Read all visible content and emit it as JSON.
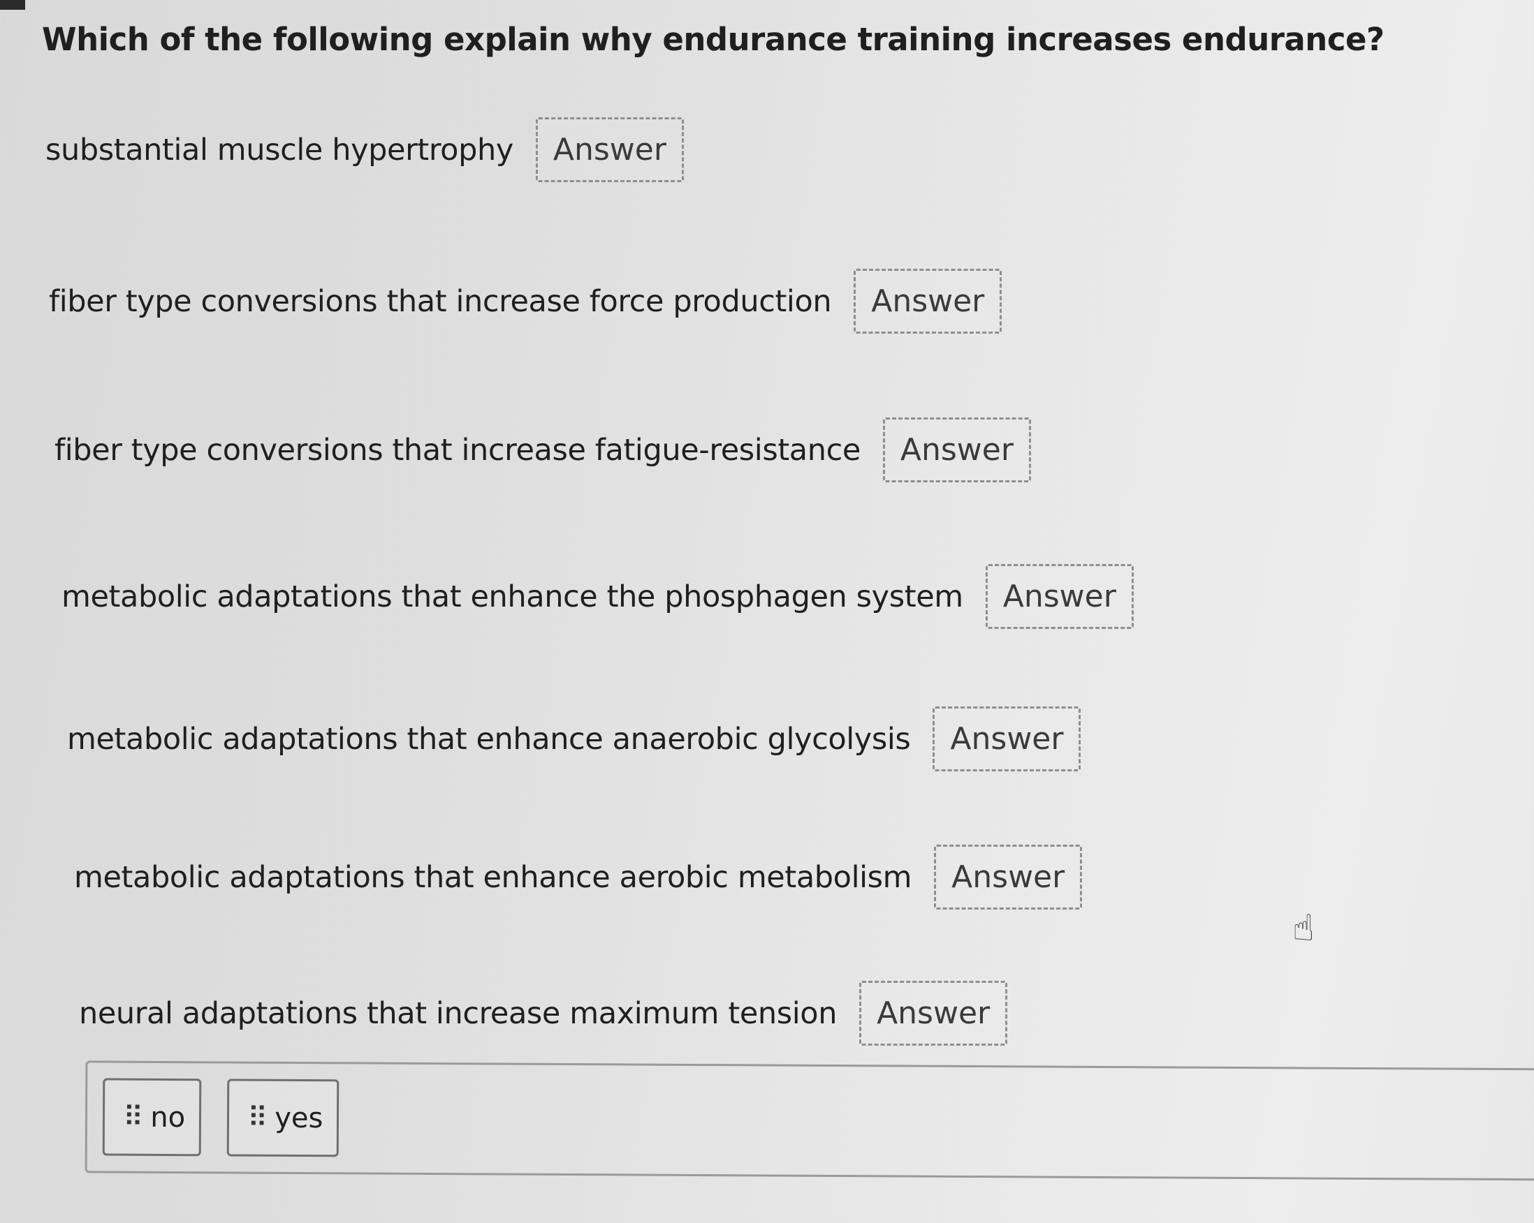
{
  "question": "Which of the following explain why endurance training increases endurance?",
  "rows": [
    {
      "label": "substantial muscle hypertrophy",
      "answer": "Answer"
    },
    {
      "label": "fiber type conversions that increase force production",
      "answer": "Answer"
    },
    {
      "label": "fiber type conversions that increase fatigue-resistance",
      "answer": "Answer"
    },
    {
      "label": "metabolic adaptations that enhance the phosphagen system",
      "answer": "Answer"
    },
    {
      "label": "metabolic adaptations that enhance anaerobic glycolysis",
      "answer": "Answer"
    },
    {
      "label": "metabolic adaptations that enhance aerobic metabolism",
      "answer": "Answer"
    },
    {
      "label": "neural adaptations that increase maximum tension",
      "answer": "Answer"
    }
  ],
  "answer_bank": [
    {
      "label": "no",
      "icon": "grip-dots-icon"
    },
    {
      "label": "yes",
      "icon": "grip-dots-icon"
    }
  ],
  "cursor_icon": "hand-pointer-icon"
}
